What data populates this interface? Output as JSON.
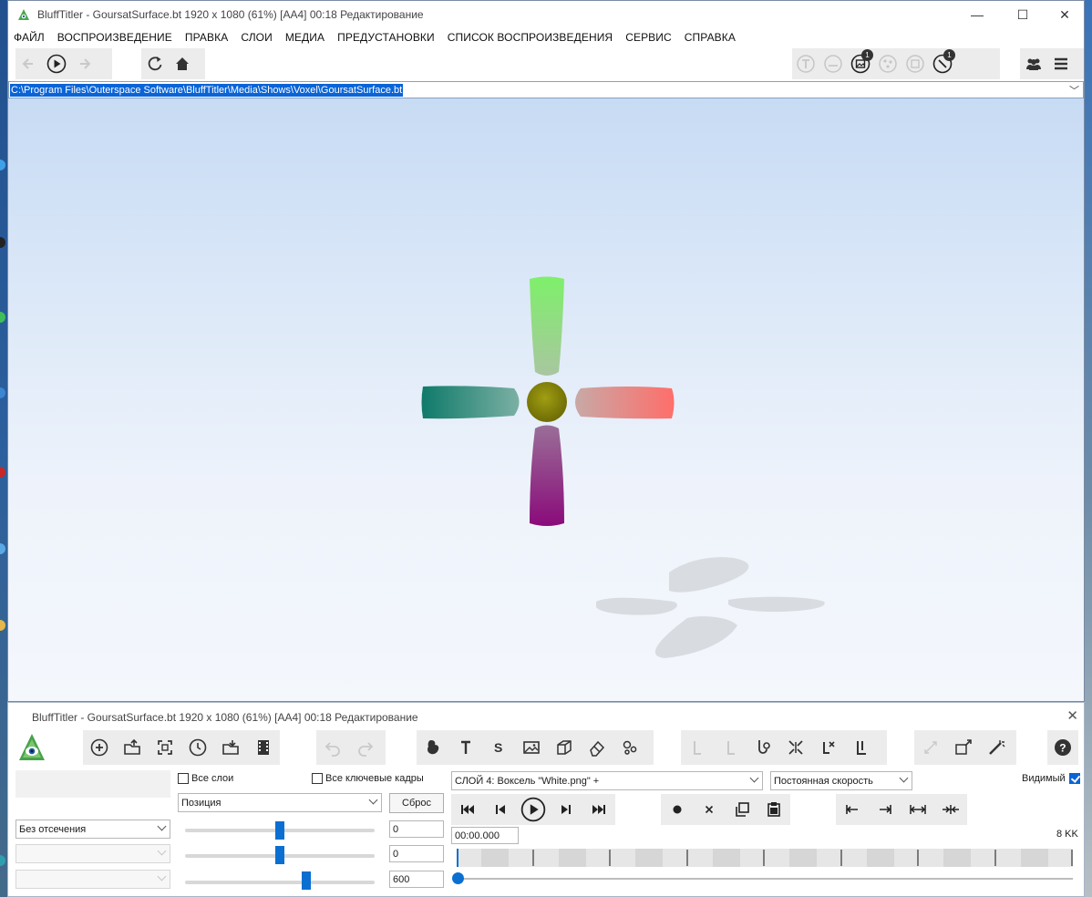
{
  "window": {
    "title": "BluffTitler - GoursatSurface.bt 1920 x 1080 (61%) [AA4] 00:18 Редактирование",
    "controls": {
      "minimize": "—",
      "maximize": "☐",
      "close": "✕"
    }
  },
  "menu": [
    "ФАЙЛ",
    "ВОСПРОИЗВЕДЕНИЕ",
    "ПРАВКА",
    "СЛОИ",
    "МЕДИА",
    "ПРЕДУСТАНОВКИ",
    "СПИСОК ВОСПРОИЗВЕДЕНИЯ",
    "СЕРВИС",
    "СПРАВКА"
  ],
  "toolbar": {
    "badges": {
      "media": "1",
      "effects": "1"
    }
  },
  "path": {
    "value": "C:\\Program Files\\Outerspace Software\\BluffTitler\\Media\\Shows\\Voxel\\GoursatSurface.bt"
  },
  "panel": {
    "title": "BluffTitler - GoursatSurface.bt 1920 x 1080 (61%) [AA4] 00:18 Редактирование",
    "close": "✕",
    "all_layers_label": "Все слои",
    "all_keyframes_label": "Все ключевые кадры",
    "property_select": "Позиция",
    "reset_label": "Сброс",
    "clipping_select": "Без отсечения",
    "values": [
      "0",
      "0",
      "600"
    ],
    "layer_select": "СЛОЙ 4: Воксель \"White.png\" +",
    "speed_select": "Постоянная скорость",
    "visible_label": "Видимый",
    "time_value": "00:00.000",
    "kk_count": "8 KK",
    "slider_levels": [
      0.5,
      0.5,
      0.64
    ],
    "keyframe_count": 8
  },
  "colors": {
    "accent": "#0a6fd1",
    "selection": "#0a64d6",
    "viewport_top": "#c7dbf4",
    "viewport_bottom": "#f4f7fc"
  }
}
